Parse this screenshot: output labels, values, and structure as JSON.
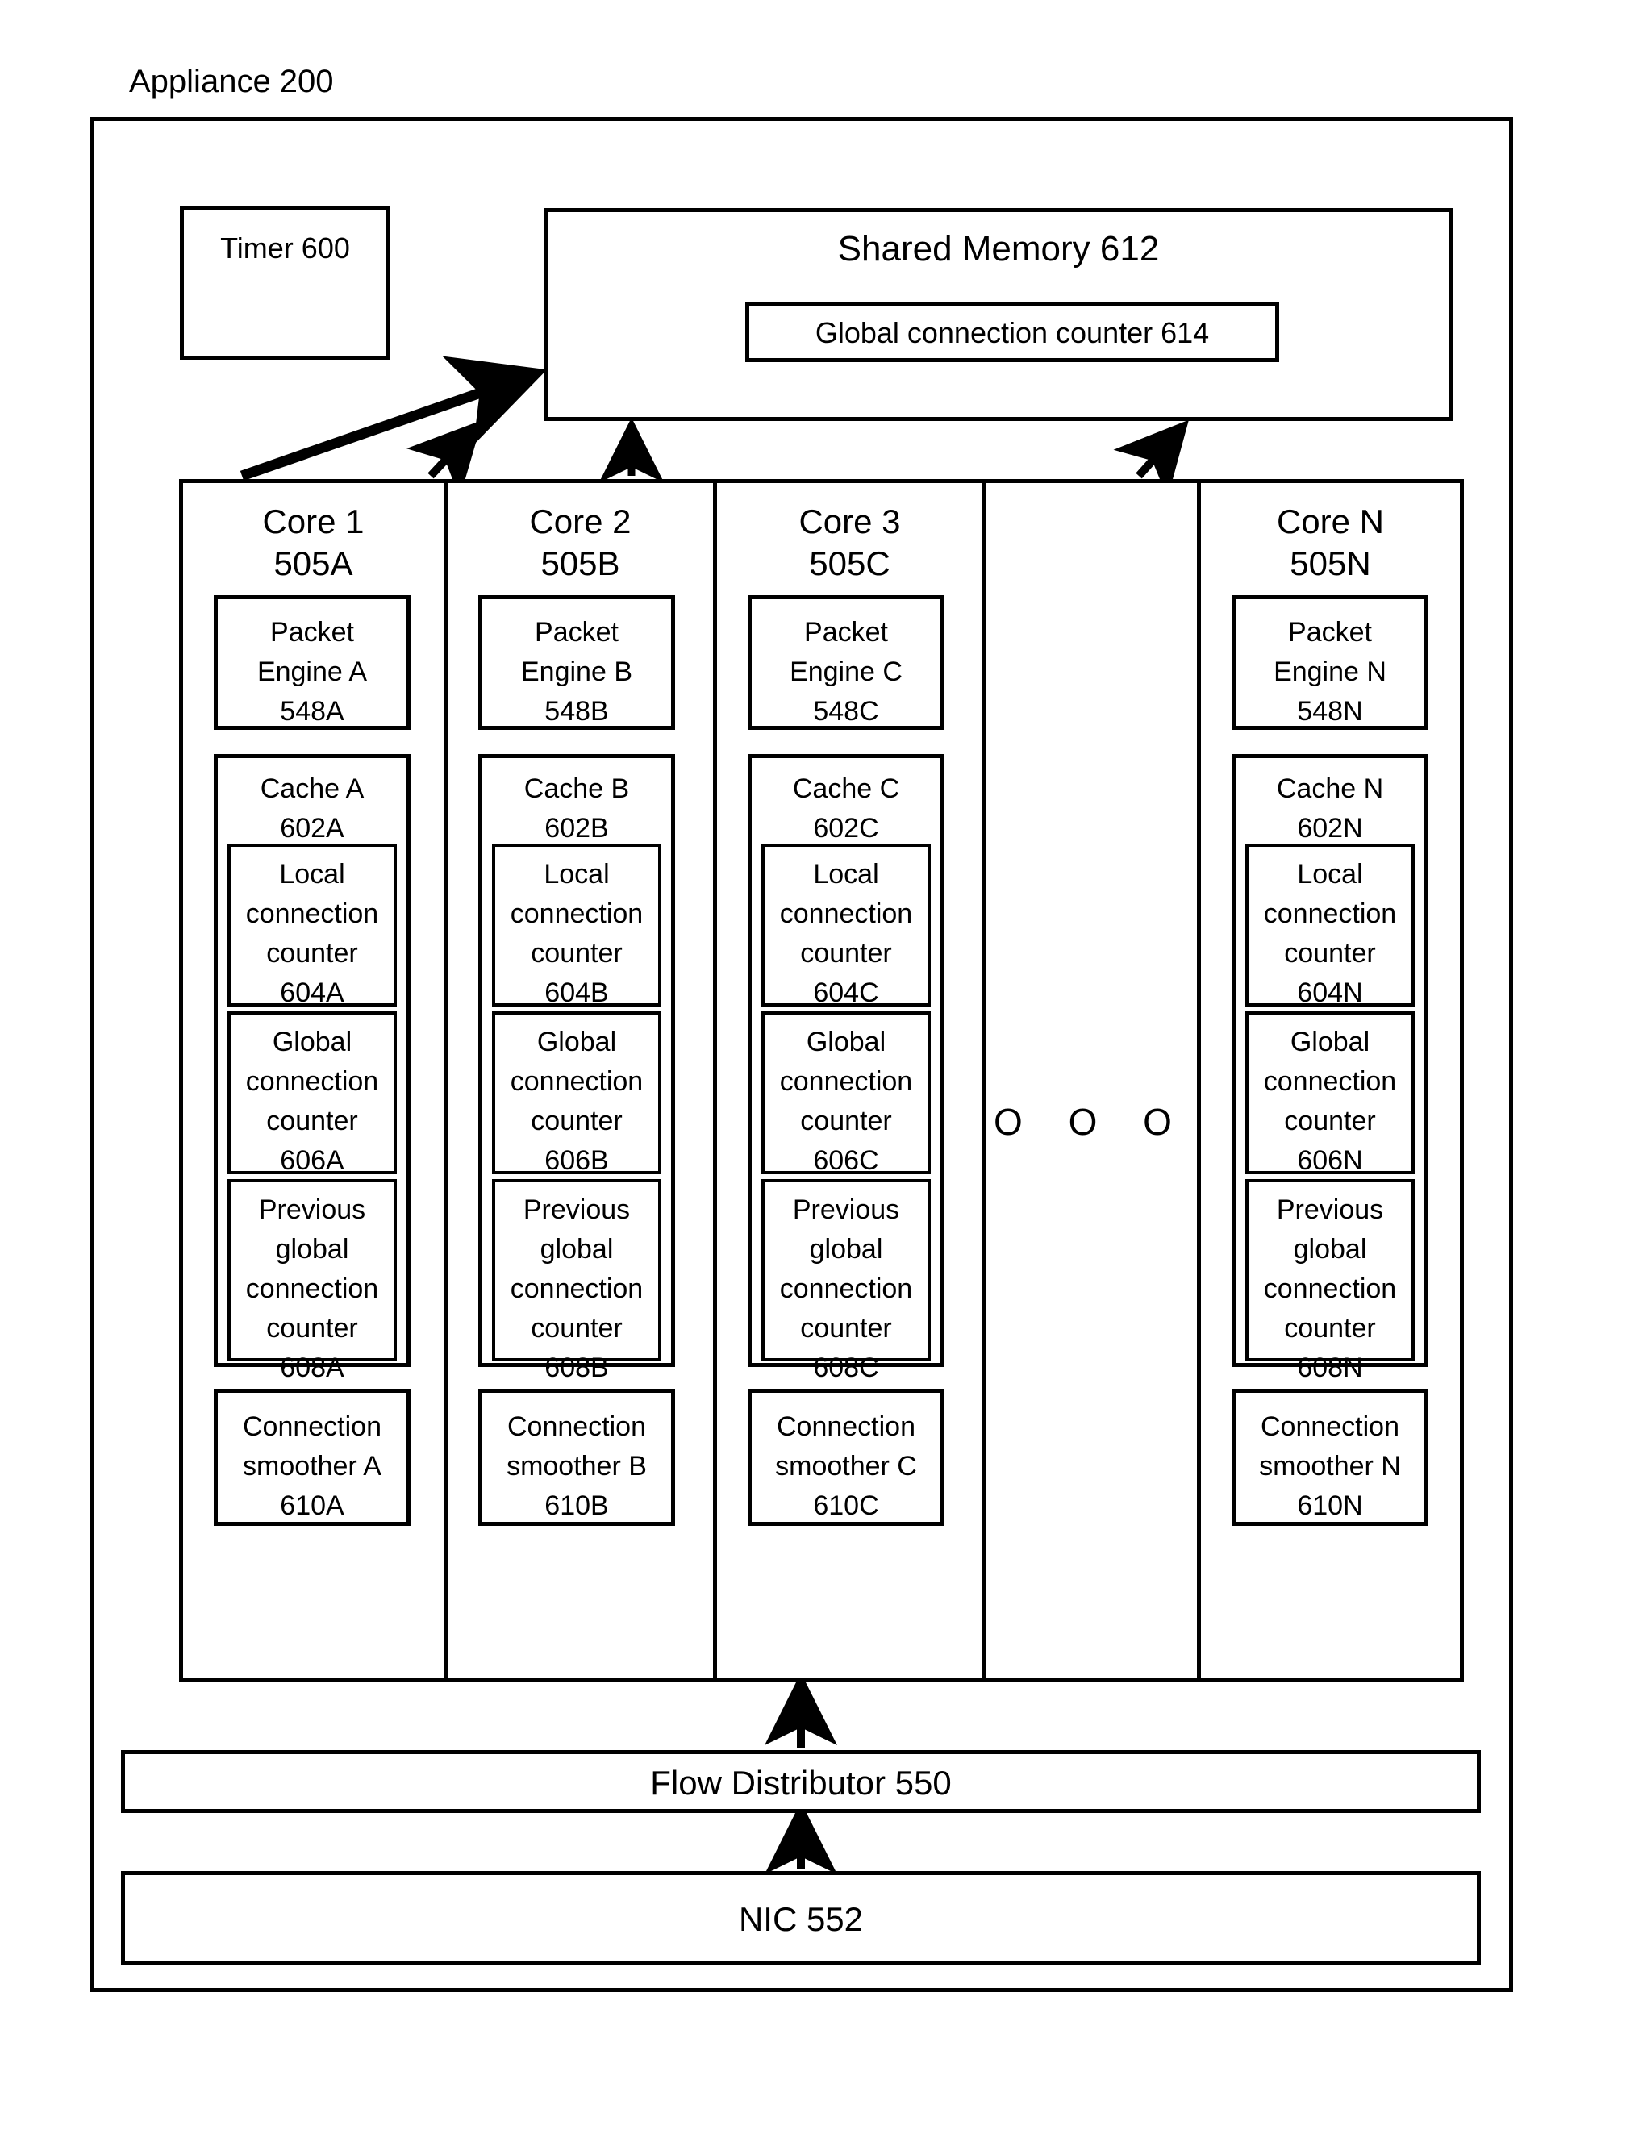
{
  "diagram": {
    "title": "Appliance 200",
    "timer": {
      "label": "Timer 600"
    },
    "shared_memory": {
      "title": "Shared Memory 612",
      "global_connection_counter": "Global connection counter 614"
    },
    "cores": [
      {
        "name": "Core 1",
        "ref": "505A",
        "packet_engine": "Packet\nEngine A\n548A",
        "packet_engine_lines": [
          "Packet",
          "Engine A",
          "548A"
        ],
        "cache_title": [
          "Cache A",
          "602A"
        ],
        "local_counter": [
          "Local",
          "connection",
          "counter",
          "604A"
        ],
        "global_counter": [
          "Global",
          "connection",
          "counter",
          "606A"
        ],
        "previous_global_counter": [
          "Previous",
          "global",
          "connection",
          "counter",
          "608A"
        ],
        "connection_smoother": [
          "Connection",
          "smoother A",
          "610A"
        ]
      },
      {
        "name": "Core 2",
        "ref": "505B",
        "packet_engine_lines": [
          "Packet",
          "Engine B",
          "548B"
        ],
        "cache_title": [
          "Cache B",
          "602B"
        ],
        "local_counter": [
          "Local",
          "connection",
          "counter",
          "604B"
        ],
        "global_counter": [
          "Global",
          "connection",
          "counter",
          "606B"
        ],
        "previous_global_counter": [
          "Previous",
          "global",
          "connection",
          "counter",
          "608B"
        ],
        "connection_smoother": [
          "Connection",
          "smoother B",
          "610B"
        ]
      },
      {
        "name": "Core 3",
        "ref": "505C",
        "packet_engine_lines": [
          "Packet",
          "Engine C",
          "548C"
        ],
        "cache_title": [
          "Cache C",
          "602C"
        ],
        "local_counter": [
          "Local",
          "connection",
          "counter",
          "604C"
        ],
        "global_counter": [
          "Global",
          "connection",
          "counter",
          "606C"
        ],
        "previous_global_counter": [
          "Previous",
          "global",
          "connection",
          "counter",
          "608C"
        ],
        "connection_smoother": [
          "Connection",
          "smoother C",
          "610C"
        ]
      },
      {
        "name": "Core N",
        "ref": "505N",
        "packet_engine_lines": [
          "Packet",
          "Engine N",
          "548N"
        ],
        "cache_title": [
          "Cache N",
          "602N"
        ],
        "local_counter": [
          "Local",
          "connection",
          "counter",
          "604N"
        ],
        "global_counter": [
          "Global",
          "connection",
          "counter",
          "606N"
        ],
        "previous_global_counter": [
          "Previous",
          "global",
          "connection",
          "counter",
          "608N"
        ],
        "connection_smoother": [
          "Connection",
          "smoother N",
          "610N"
        ]
      }
    ],
    "ellipsis": "O O O",
    "flow_distributor": {
      "label": "Flow Distributor 550"
    },
    "nic": {
      "label": "NIC 552"
    },
    "colors": {
      "stroke": "#000000",
      "background": "#ffffff"
    }
  }
}
